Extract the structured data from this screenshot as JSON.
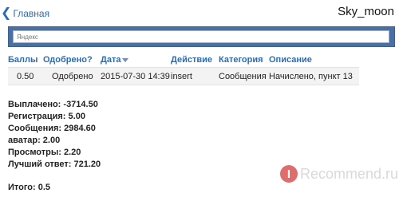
{
  "header": {
    "back_label": "Главная",
    "username": "Sky_moon"
  },
  "search": {
    "placeholder": "Яндекс"
  },
  "table": {
    "columns": [
      "Баллы",
      "Одобрено?",
      "Дата",
      "Действие",
      "Категория",
      "Описание"
    ],
    "rows": [
      {
        "points": "0.50",
        "approved": "Одобрено",
        "date": "2015-07-30 14:39",
        "action": "insert",
        "category": "Сообщения",
        "description": "Начислено, пункт 13"
      }
    ]
  },
  "stats": [
    "Выплачено: -3714.50",
    "Регистрация: 5.00",
    "Сообщения: 2984.60",
    "аватар: 2.00",
    "Просмотры: 2.20",
    "Лучший ответ: 721.20"
  ],
  "total": "Итого: 0.5",
  "watermark": {
    "logo_letter": "I",
    "text": "Recommend.ru"
  },
  "colors": {
    "link": "#2a6db3",
    "search_bar": "#4a6fa4",
    "row_bg": "#f3f3f3"
  }
}
